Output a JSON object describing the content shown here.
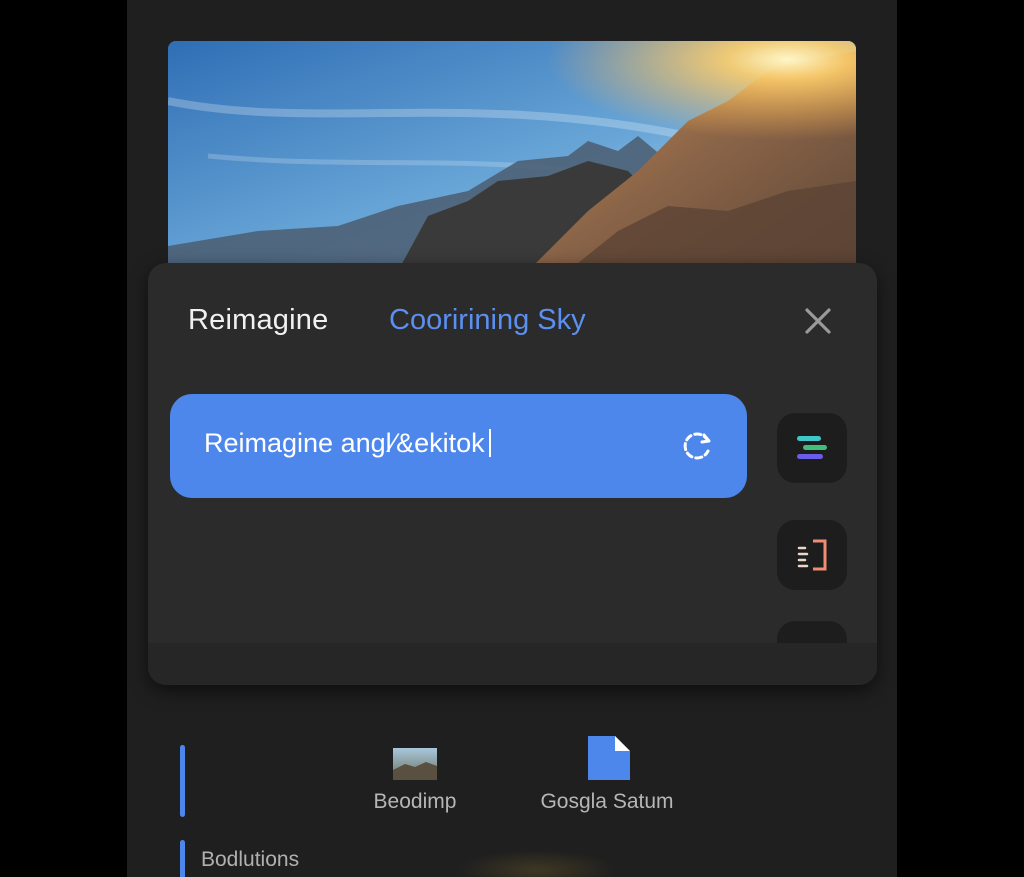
{
  "colors": {
    "accent": "#4e87ec",
    "tab_text": "#5b8ff0",
    "panel": "#2b2b2b",
    "background": "#1f1f1f"
  },
  "hero": {
    "icon": "mountain-photo"
  },
  "sheet": {
    "title": "Reimagine",
    "tab": "Cooririning Sky",
    "close_icon": "close-icon",
    "prompt": {
      "value": "Reimagine angl⁄&ekitok",
      "action_icon": "regenerate-icon"
    },
    "side_buttons": [
      {
        "icon": "style-layers-icon"
      },
      {
        "icon": "edit-frame-icon"
      },
      {
        "icon": "more-icon"
      }
    ]
  },
  "bottom": {
    "shortcuts": [
      {
        "label": "Beodimp",
        "icon": "photo-thumbnail-icon"
      },
      {
        "label": "Gosgla Satum",
        "icon": "document-icon"
      }
    ],
    "section_label": "Bodlutions"
  }
}
